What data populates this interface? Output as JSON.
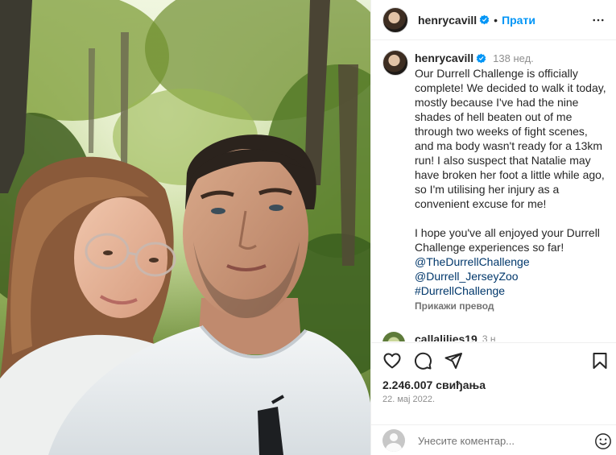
{
  "post": {
    "username": "henrycavill",
    "follow_label": "Прати",
    "caption_time": "138 нед.",
    "caption_text": "Our Durrell Challenge is officially complete! We decided to walk it today, mostly because I've had the nine shades of hell beaten out of me through two weeks of fight scenes, and ma body wasn't ready for a 13km run! I also suspect that Natalie may have broken her foot a little while ago, so I'm utilising her injury as a convenient excuse for me!\n\nI hope you've all enjoyed your Durrell Challenge experiences so far!\n",
    "tags": [
      "@TheDurrellChallenge",
      "@Durrell_JerseyZoo",
      "#DurrellChallenge"
    ],
    "translate_label": "Прикажи превод",
    "comment_peek": {
      "username": "callalilies19",
      "time": "3 н"
    },
    "likes": "2.246.007 свиђања",
    "date": "22. мај 2022.",
    "comment_placeholder": "Унесите коментар..."
  },
  "icons": {
    "verified": "verified-badge-icon",
    "more": "more-options-icon",
    "like": "heart-icon",
    "comment": "comment-bubble-icon",
    "share": "paper-plane-icon",
    "save": "bookmark-icon",
    "emoji": "smiley-icon"
  },
  "colors": {
    "accent": "#0095f6",
    "link": "#00376b",
    "muted": "#8e8e8e",
    "text": "#262626"
  }
}
